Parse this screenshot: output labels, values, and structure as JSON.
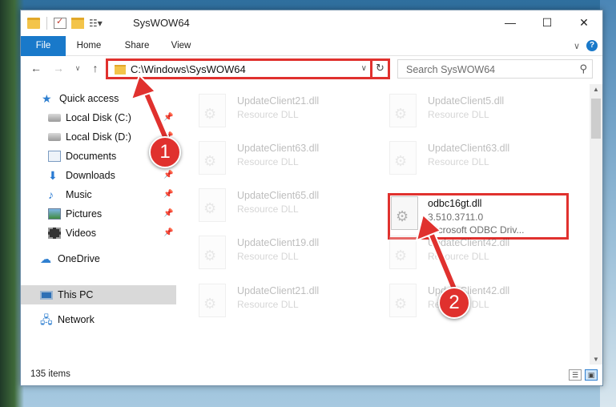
{
  "window": {
    "title": "SysWOW64"
  },
  "ribbon": {
    "tabs": [
      "File",
      "Home",
      "Share",
      "View"
    ]
  },
  "address": {
    "path": "C:\\Windows\\SysWOW64"
  },
  "search": {
    "placeholder": "Search SysWOW64"
  },
  "nav": {
    "items": [
      {
        "label": "Quick access"
      },
      {
        "label": "Local Disk (C:)"
      },
      {
        "label": "Local Disk (D:)"
      },
      {
        "label": "Documents"
      },
      {
        "label": "Downloads"
      },
      {
        "label": "Music"
      },
      {
        "label": "Pictures"
      },
      {
        "label": "Videos"
      },
      {
        "label": "OneDrive"
      },
      {
        "label": "This PC"
      },
      {
        "label": "Network"
      }
    ]
  },
  "files": [
    {
      "name": "UpdateClient21.dll",
      "type": "Resource DLL"
    },
    {
      "name": "UpdateClient5.dll",
      "type": "Resource DLL"
    },
    {
      "name": "UpdateClient63.dll",
      "type": "Resource DLL"
    },
    {
      "name": "UpdateClient63.dll",
      "type": "Resource DLL"
    },
    {
      "name": "UpdateClient65.dll",
      "type": "Resource DLL"
    },
    {
      "name": "odbc16gt.dll",
      "type": "3.510.3711.0",
      "desc": "Microsoft ODBC Driv..."
    },
    {
      "name": "UpdateClient19.dll",
      "type": "Resource DLL"
    },
    {
      "name": "UpdateClient42.dll",
      "type": "Resource DLL"
    },
    {
      "name": "UpdateClient21.dll",
      "type": "Resource DLL"
    },
    {
      "name": "UpdateClient42.dll",
      "type": "Resource DLL"
    }
  ],
  "status": {
    "count": "135 items"
  },
  "markers": {
    "one": "1",
    "two": "2"
  },
  "colors": {
    "accent": "#1979ca",
    "highlight": "#e0312e"
  }
}
